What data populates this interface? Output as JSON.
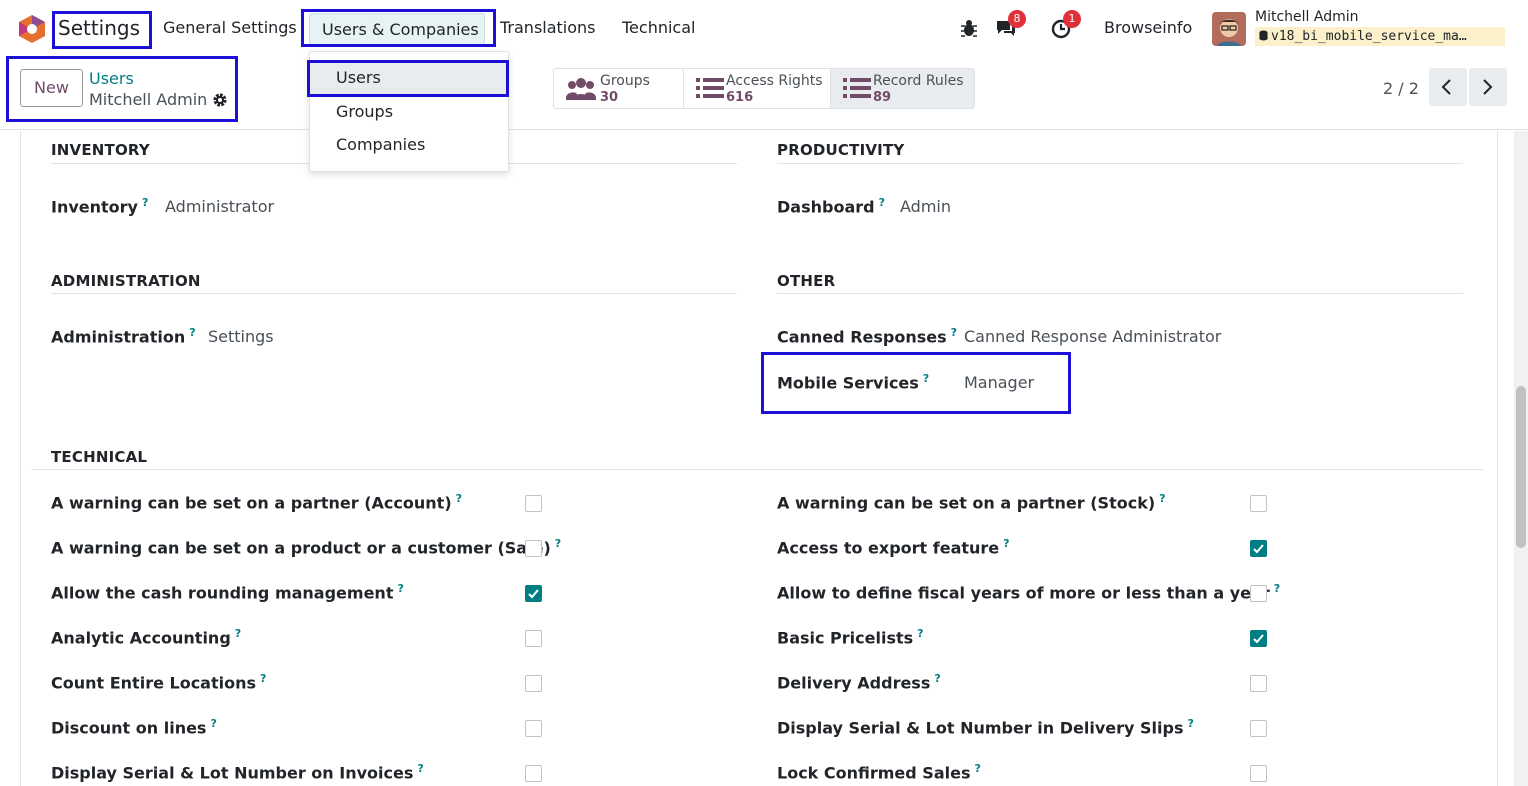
{
  "navbar": {
    "app_name": "Settings",
    "menus": [
      "General Settings",
      "Users & Companies",
      "Translations",
      "Technical"
    ],
    "messages_count": "8",
    "activities_count": "1",
    "company": "Browseinfo",
    "user_name": "Mitchell Admin",
    "database": "v18_bi_mobile_service_ma…"
  },
  "dropdown": {
    "items": [
      "Users",
      "Groups",
      "Companies"
    ]
  },
  "control": {
    "new_label": "New",
    "breadcrumb_parent": "Users",
    "breadcrumb_current": "Mitchell Admin",
    "stats": [
      {
        "label": "Groups",
        "value": "30"
      },
      {
        "label": "Access Rights",
        "value": "616"
      },
      {
        "label": "Record Rules",
        "value": "89"
      }
    ],
    "pager": "2 / 2"
  },
  "sections": {
    "inventory": {
      "title": "INVENTORY",
      "field": "Inventory",
      "value": "Administrator"
    },
    "productivity": {
      "title": "PRODUCTIVITY",
      "field": "Dashboard",
      "value": "Admin"
    },
    "administration": {
      "title": "ADMINISTRATION",
      "field": "Administration",
      "value": "Settings"
    },
    "other": {
      "title": "OTHER",
      "fields": [
        {
          "label": "Canned Responses",
          "value": "Canned Response Administrator"
        },
        {
          "label": "Mobile Services",
          "value": "Manager"
        }
      ]
    },
    "technical": {
      "title": "TECHNICAL"
    }
  },
  "technical_left": [
    {
      "label": "A warning can be set on a partner (Account)",
      "checked": false
    },
    {
      "label": "A warning can be set on a product or a customer (Sale)",
      "checked": false
    },
    {
      "label": "Allow the cash rounding management",
      "checked": true
    },
    {
      "label": "Analytic Accounting",
      "checked": false
    },
    {
      "label": "Count Entire Locations",
      "checked": false
    },
    {
      "label": "Discount on lines",
      "checked": false
    },
    {
      "label": "Display Serial & Lot Number on Invoices",
      "checked": false
    }
  ],
  "technical_right": [
    {
      "label": "A warning can be set on a partner (Stock)",
      "checked": false
    },
    {
      "label": "Access to export feature",
      "checked": true
    },
    {
      "label": "Allow to define fiscal years of more or less than a year",
      "checked": false
    },
    {
      "label": "Basic Pricelists",
      "checked": true
    },
    {
      "label": "Delivery Address",
      "checked": false
    },
    {
      "label": "Display Serial & Lot Number in Delivery Slips",
      "checked": false
    },
    {
      "label": "Lock Confirmed Sales",
      "checked": false
    }
  ],
  "help_mark": "?",
  "colors": {
    "accent": "#017e84",
    "brand": "#714b67",
    "highlight": "#1c0fd6"
  }
}
